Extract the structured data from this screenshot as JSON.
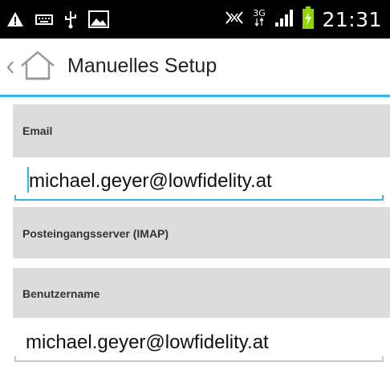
{
  "status_bar": {
    "clock": "21:31",
    "network": "3G",
    "icons": [
      "warning-icon",
      "keyboard-icon",
      "usb-icon",
      "image-icon",
      "nfc-icon",
      "network-3g-icon",
      "signal-icon",
      "battery-icon"
    ]
  },
  "action_bar": {
    "title": "Manuelles Setup",
    "accent_color": "#33b5e5"
  },
  "form": {
    "email_label": "Email",
    "email_value": "michael.geyer@lowfidelity.at",
    "incoming_server_label": "Posteingangsserver (IMAP)",
    "username_label": "Benutzername",
    "username_value": "michael.geyer@lowfidelity.at"
  }
}
